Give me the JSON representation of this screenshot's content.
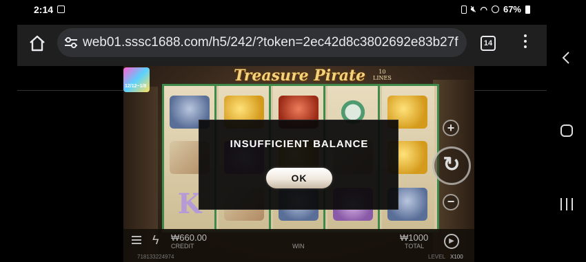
{
  "status_bar": {
    "time": "2:14",
    "battery": "67%"
  },
  "browser": {
    "url": "web01.sssc1688.com/h5/242/?token=2ec42d8c3802692e83b27f",
    "tab_count": "14"
  },
  "game": {
    "title": "Treasure Pirate",
    "lines_badge_number": "10",
    "lines_badge_text": "LINES",
    "logo_text": "12/12~1/8",
    "credit_value": "₩660.00",
    "credit_label": "CREDIT",
    "win_label": "WIN",
    "total_value": "₩1000",
    "total_label": "TOTAL",
    "round_id": "718133224974",
    "level_label": "LEVEL",
    "level_value": "X100",
    "reel_letter": "K"
  },
  "dialog": {
    "message": "INSUFFICIENT BALANCE",
    "ok_label": "OK"
  },
  "icons": {
    "home": "home-icon",
    "site_settings": "tune-icon",
    "tabs": "tab-switcher-icon",
    "menu": "more-vert-icon",
    "spin": "spin-icon",
    "back": "back-icon",
    "recents": "recents-icon"
  }
}
